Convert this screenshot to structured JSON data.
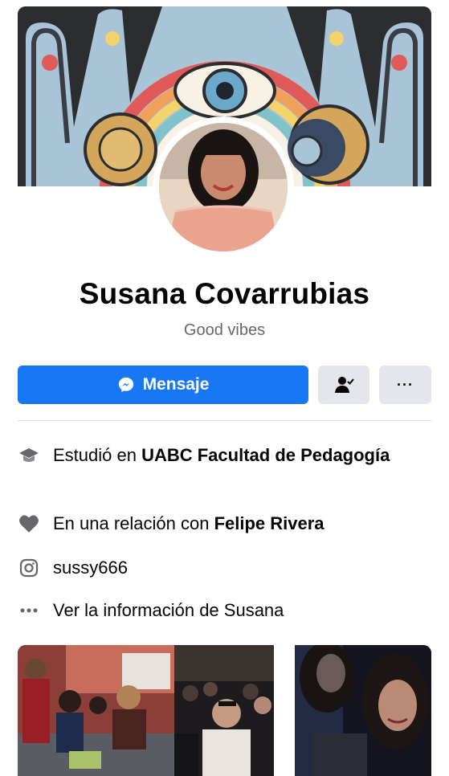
{
  "profile": {
    "name": "Susana Covarrubias",
    "bio": "Good vibes"
  },
  "actions": {
    "message_label": "Mensaje",
    "friend_icon": "friend-check-icon",
    "more_icon": "more-icon",
    "more_label": "···"
  },
  "info": {
    "education": {
      "prefix": "Estudió en ",
      "place": "UABC Facultad de Pedagogía",
      "icon": "graduation-cap-icon"
    },
    "relationship": {
      "prefix": "En una relación con ",
      "partner": "Felipe Rivera",
      "icon": "heart-icon"
    },
    "instagram": {
      "handle": "sussy666",
      "icon": "instagram-icon"
    },
    "about": {
      "label": "Ver la información de Susana",
      "icon": "more-icon"
    }
  },
  "colors": {
    "primary": "#1877f2",
    "secondary_bg": "#e4e6eb",
    "secondary_text": "#65676b",
    "icon_gray": "#8a8d91"
  }
}
